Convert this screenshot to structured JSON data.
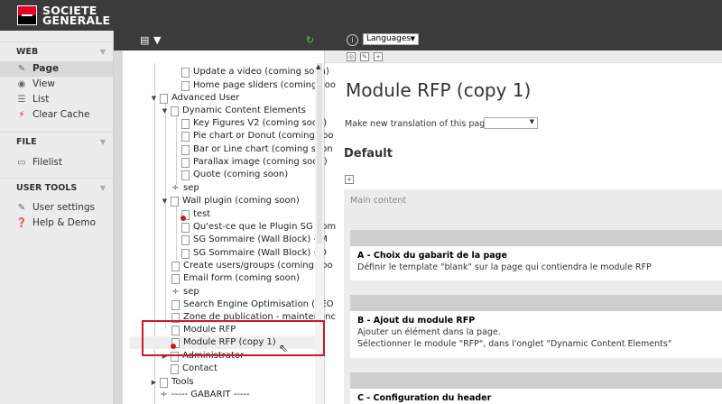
{
  "brand": {
    "line1": "SOCIETE",
    "line2": "GENERALE",
    "red": "#e60028",
    "header_bg": "#3b3b3b",
    "highlight": "#d0172a"
  },
  "modmenu": {
    "groups": [
      {
        "label": "WEB",
        "items": [
          {
            "label": "Page",
            "icon": "page-edit-icon",
            "active": true
          },
          {
            "label": "View",
            "icon": "eye-icon"
          },
          {
            "label": "List",
            "icon": "list-icon"
          },
          {
            "label": "Clear Cache",
            "icon": "lightning-icon"
          }
        ]
      },
      {
        "label": "FILE",
        "items": [
          {
            "label": "Filelist",
            "icon": "folder-icon"
          }
        ]
      },
      {
        "label": "USER TOOLS",
        "items": [
          {
            "label": "User settings",
            "icon": "user-settings-icon"
          },
          {
            "label": "Help & Demo",
            "icon": "help-icon"
          }
        ]
      }
    ]
  },
  "tree": {
    "nodes": [
      {
        "label": "Update a video (coming soon)"
      },
      {
        "label": "Home page sliders (coming soo"
      },
      {
        "label": "Advanced User"
      },
      {
        "label": "Dynamic Content Elements"
      },
      {
        "label": "Key Figures V2 (coming soon)"
      },
      {
        "label": "Pie chart or Donut (coming soo"
      },
      {
        "label": "Bar or Line chart (coming soon"
      },
      {
        "label": "Parallax image (coming soon)"
      },
      {
        "label": "Quote (coming soon)"
      },
      {
        "label": "sep"
      },
      {
        "label": "Wall plugin (coming soon)"
      },
      {
        "label": "test"
      },
      {
        "label": "Qu'est-ce que le Plugin SG Som"
      },
      {
        "label": "SG Sommaire (Wall Block) - M"
      },
      {
        "label": "SG Sommaire (Wall Block) - D"
      },
      {
        "label": "Create users/groups (coming soo"
      },
      {
        "label": "Email form (coming soon)"
      },
      {
        "label": "sep"
      },
      {
        "label": "Search Engine Optimisation (SEO"
      },
      {
        "label": "Zone de publication - maintenanc"
      },
      {
        "label": "Module RFP"
      },
      {
        "label": "Module RFP (copy 1)"
      },
      {
        "label": "Administrator"
      },
      {
        "label": "Contact"
      },
      {
        "label": "Tools"
      },
      {
        "label": "----- GABARIT -----"
      }
    ]
  },
  "toolbar": {
    "languages": "Languages"
  },
  "content": {
    "page_title": "Module RFP (copy 1)",
    "translation_label": "Make new translation of this page:",
    "column_heading": "Default",
    "main_content_label": "Main content",
    "elements": [
      {
        "title": "A - Choix du gabarit de la page",
        "lines": [
          "Définir le template \"blank\" sur la page qui contiendra le module RFP"
        ]
      },
      {
        "title": "B - Ajout du module RFP",
        "lines": [
          "Ajouter un élément dans la page.",
          "Sélectionner le module \"RFP\", dans l'onglet \"Dynamic Content Elements\""
        ]
      },
      {
        "title": "C - Configuration du header",
        "lines": []
      }
    ]
  }
}
